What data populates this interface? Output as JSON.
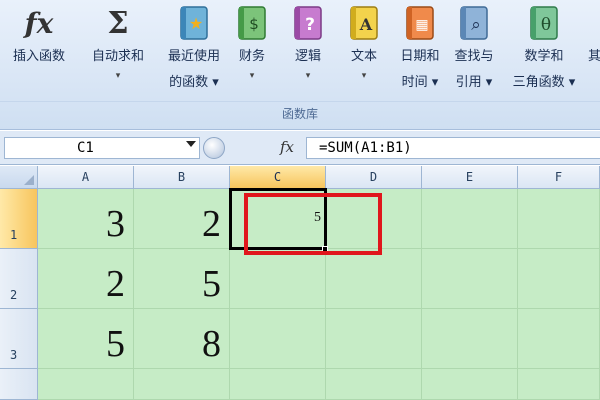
{
  "ribbon": {
    "buttons": [
      {
        "label": "插入函数",
        "icon": "fx"
      },
      {
        "label": "自动求和",
        "sub": "▾",
        "icon": "Σ"
      },
      {
        "label": "最近使用",
        "sub": "的函数 ▾",
        "icon": "★"
      },
      {
        "label": "财务",
        "sub": "▾",
        "icon": "$"
      },
      {
        "label": "逻辑",
        "sub": "▾",
        "icon": "?"
      },
      {
        "label": "文本",
        "sub": "▾",
        "icon": "A"
      },
      {
        "label": "日期和",
        "sub": "时间 ▾",
        "icon": "▦"
      },
      {
        "label": "查找与",
        "sub": "引用 ▾",
        "icon": "⌕"
      },
      {
        "label": "数学和",
        "sub": "三角函数 ▾",
        "icon": "θ"
      },
      {
        "label": "其"
      }
    ],
    "group_label": "函数库"
  },
  "formula_bar": {
    "name_box": "C1",
    "fx_label": "fx",
    "formula": "=SUM(A1:B1)"
  },
  "grid": {
    "columns": [
      "A",
      "B",
      "C",
      "D",
      "E",
      "F"
    ],
    "rows": [
      "1",
      "2",
      "3"
    ],
    "cells": {
      "A1": "3",
      "B1": "2",
      "C1": "5",
      "A2": "2",
      "B2": "5",
      "A3": "5",
      "B3": "8"
    },
    "active_cell": "C1"
  },
  "colors": {
    "cell_background": "#c6ecc6",
    "annotation": "#e0161c",
    "ribbon": "#dbe7f6"
  }
}
